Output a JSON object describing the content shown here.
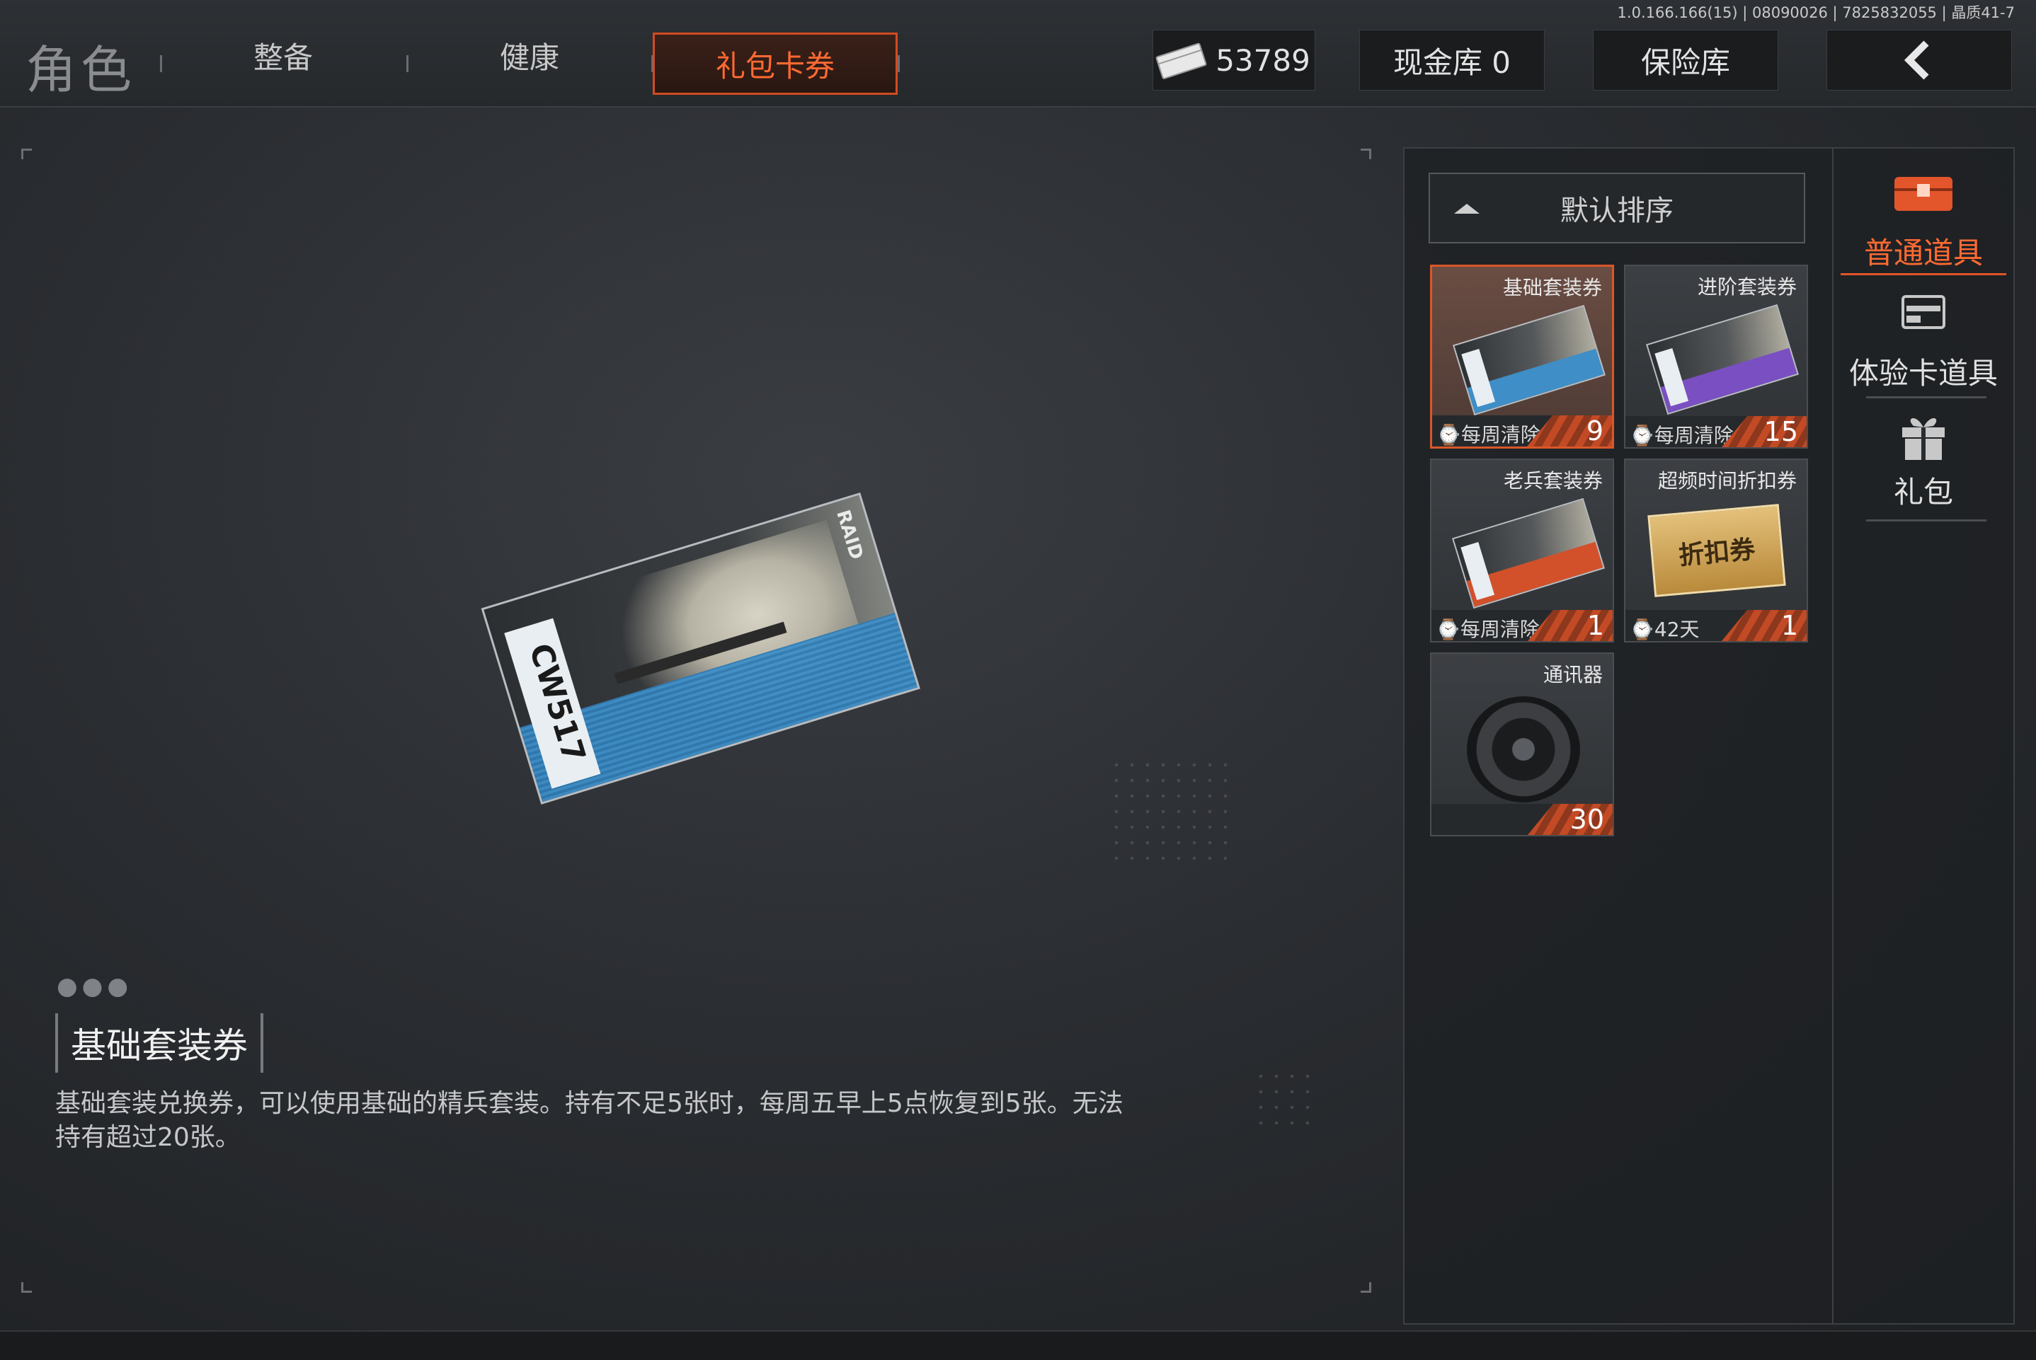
{
  "app": {
    "version": "1.0.166.166(15) | 08090026 | 7825832055 | 晶质41-7"
  },
  "header": {
    "title": "角色",
    "tabs": [
      {
        "label": "整备",
        "active": false
      },
      {
        "label": "健康",
        "active": false
      },
      {
        "label": "礼包卡券",
        "active": true
      }
    ],
    "currency_value": "53789",
    "cash_vault_label": "现金库 0",
    "safe_label": "保险库",
    "accent_color": "#d24b22"
  },
  "item_detail": {
    "card_text": "CW517",
    "card_side_text": "RAID",
    "name": "基础套装券",
    "description": "基础套装兑换券，可以使用基础的精兵套装。持有不足5张时，每周五早上5点恢复到5张。无法持有超过20张。"
  },
  "inventory": {
    "sort_label": "默认排序",
    "items": [
      {
        "name": "基础套装券",
        "expiry": "每周清除",
        "count": "9",
        "selected": true,
        "stripe_color": "#3f8ec7"
      },
      {
        "name": "进阶套装券",
        "expiry": "每周清除",
        "count": "15",
        "selected": false,
        "stripe_color": "#7a4fc2"
      },
      {
        "name": "老兵套装券",
        "expiry": "每周清除",
        "count": "1",
        "selected": false,
        "stripe_color": "#d2502a"
      },
      {
        "name": "超频时间折扣券",
        "expiry": "42天",
        "count": "1",
        "selected": false,
        "coupon_text": "折扣券"
      },
      {
        "name": "通讯器",
        "expiry": "",
        "count": "30",
        "selected": false
      }
    ]
  },
  "categories": [
    {
      "label": "普通道具",
      "icon": "chest-icon",
      "active": true
    },
    {
      "label": "体验卡道具",
      "icon": "card-icon",
      "active": false
    },
    {
      "label": "礼包",
      "icon": "gift-icon",
      "active": false
    }
  ]
}
